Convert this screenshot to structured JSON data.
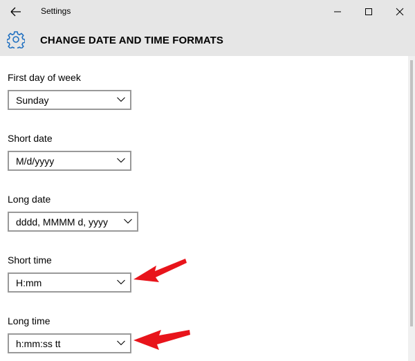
{
  "window": {
    "title": "Settings",
    "back_icon": "back-arrow-icon",
    "minimize_icon": "minimize-icon",
    "maximize_icon": "maximize-icon",
    "close_icon": "close-icon"
  },
  "header": {
    "icon": "gear-icon",
    "title": "CHANGE DATE AND TIME FORMATS"
  },
  "fields": [
    {
      "label": "First day of week",
      "value": "Sunday"
    },
    {
      "label": "Short date",
      "value": "M/d/yyyy"
    },
    {
      "label": "Long date",
      "value": "dddd, MMMM d, yyyy"
    },
    {
      "label": "Short time",
      "value": "H:mm"
    },
    {
      "label": "Long time",
      "value": "h:mm:ss tt"
    }
  ],
  "annotations": {
    "arrow_color": "#e8141b",
    "arrow_icon": "red-pointer-arrow-icon"
  },
  "colors": {
    "titlebar": "#e6e6e6",
    "dropdown_border": "#999999",
    "background": "#ffffff"
  }
}
